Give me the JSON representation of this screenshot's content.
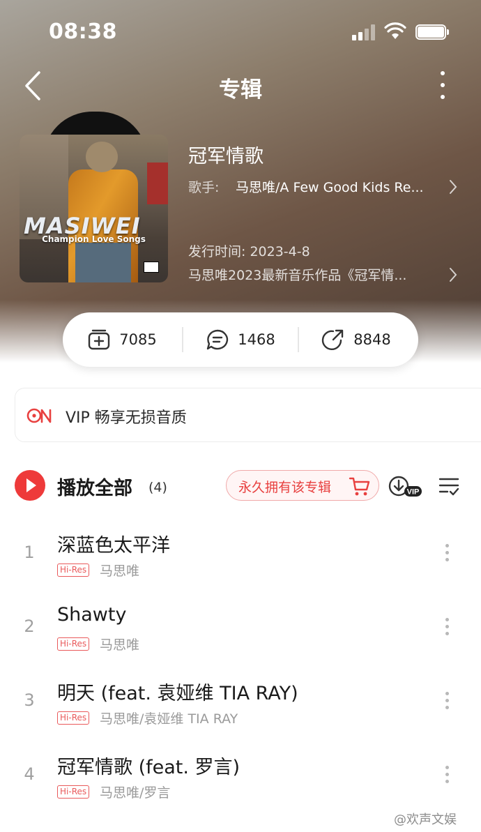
{
  "status_bar": {
    "time": "08:38"
  },
  "nav": {
    "title": "专辑"
  },
  "album": {
    "cover_logo": "MASIWEI",
    "cover_subtitle": "Champion Love Songs",
    "title": "冠军情歌",
    "artist_label": "歌手:",
    "artist": "马思唯/A Few Good Kids Re...",
    "release": "发行时间: 2023-4-8",
    "description": "马思唯2023最新音乐作品《冠军情..."
  },
  "stats": {
    "collect": "7085",
    "comments": "1468",
    "shares": "8848"
  },
  "vip_banner": {
    "text": "VIP 畅享无损音质"
  },
  "toolbar": {
    "play_all": "播放全部",
    "count": "(4)",
    "buy_label": "永久拥有该专辑",
    "download_badge": "VIP"
  },
  "songs": [
    {
      "no": "1",
      "title": "深蓝色太平洋",
      "badge": "Hi-Res",
      "artist": "马思唯"
    },
    {
      "no": "2",
      "title": "Shawty",
      "badge": "Hi-Res",
      "artist": "马思唯"
    },
    {
      "no": "3",
      "title": "明天 (feat. 袁娅维 TIA RAY)",
      "badge": "Hi-Res",
      "artist": "马思唯/袁娅维 TIA RAY"
    },
    {
      "no": "4",
      "title": "冠军情歌 (feat. 罗言)",
      "badge": "Hi-Res",
      "artist": "马思唯/罗言"
    }
  ],
  "watermark": "@欢声文娱",
  "colors": {
    "accent_red": "#ee3a3a",
    "hires_red": "#e9595a"
  }
}
